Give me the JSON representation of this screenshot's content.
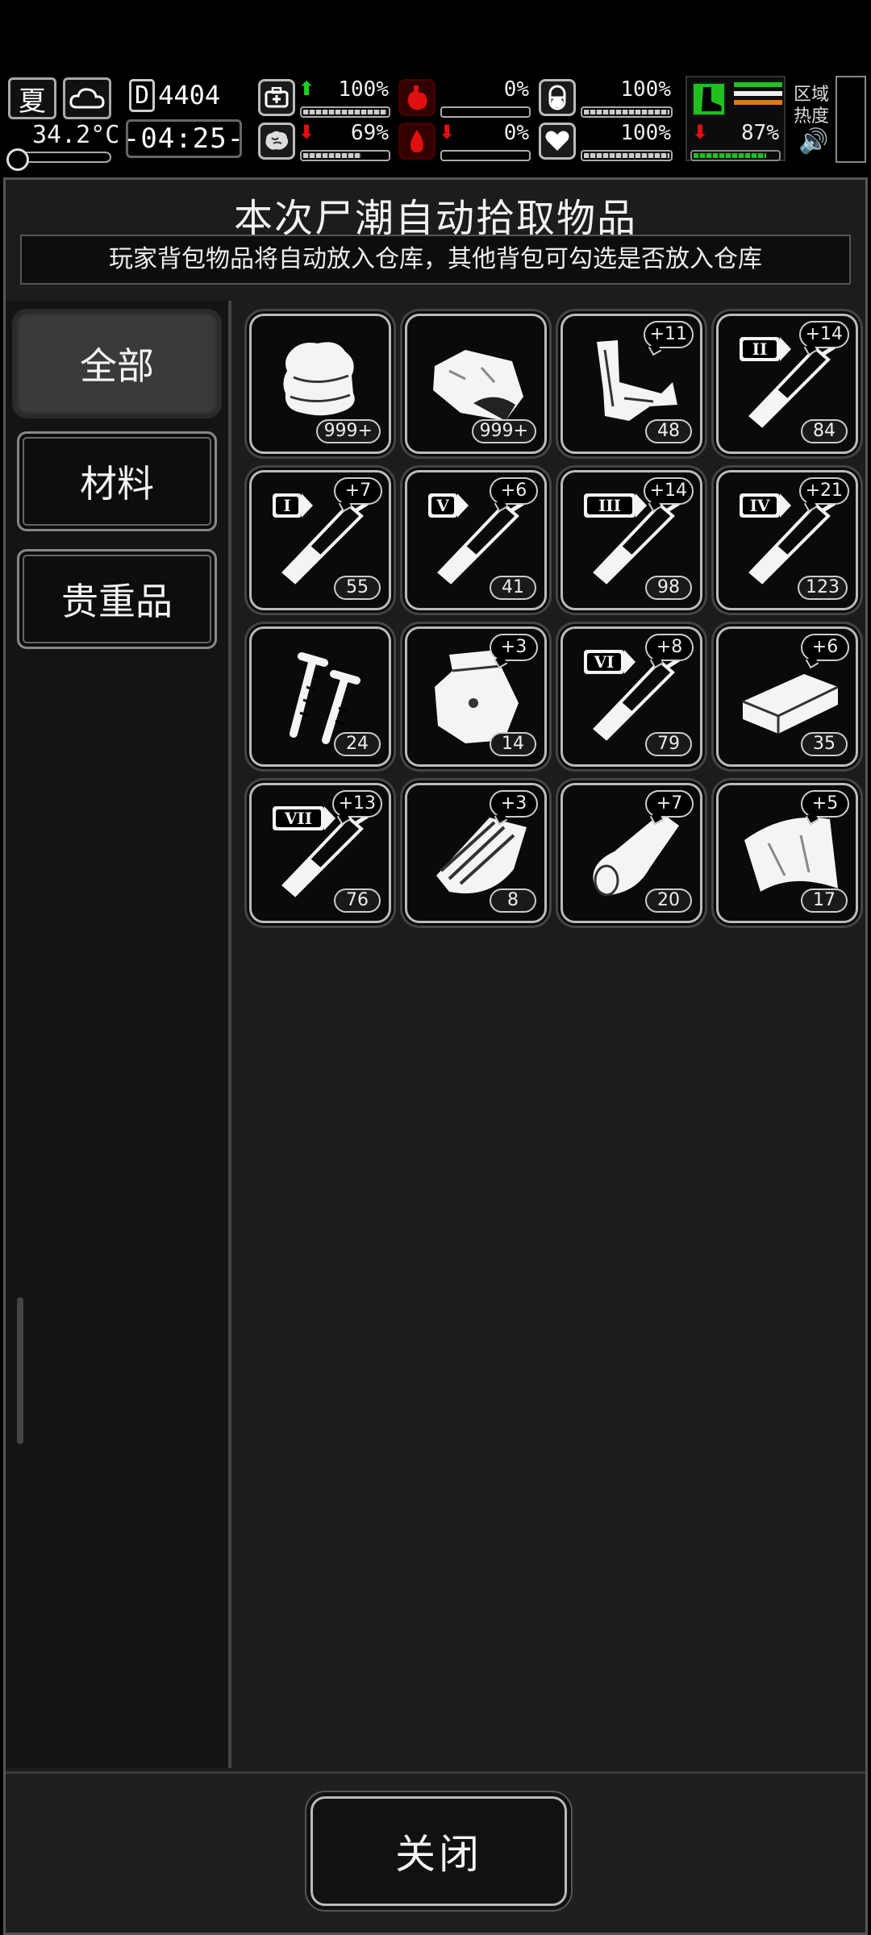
{
  "hud": {
    "season": "夏",
    "temperature": "34.2°C",
    "day": "4404",
    "day_prefix": "D",
    "clock": "-04:25-",
    "stats": [
      {
        "name": "health",
        "value": "100%",
        "trend": "up"
      },
      {
        "name": "hunger",
        "value": "0%",
        "trend": "none"
      },
      {
        "name": "pill",
        "value": "100%",
        "trend": "none"
      },
      {
        "name": "sanity",
        "value": "69%",
        "trend": "down"
      },
      {
        "name": "blood",
        "value": "0%",
        "trend": "down"
      },
      {
        "name": "heart",
        "value": "100%",
        "trend": "none"
      },
      {
        "name": "stamina",
        "value": "87%",
        "trend": "down"
      }
    ],
    "area_label_1": "区域",
    "area_label_2": "热度"
  },
  "panel": {
    "title": "本次尸潮自动拾取物品",
    "subtitle": "玩家背包物品将自动放入仓库，其他背包可勾选是否放入仓库"
  },
  "tabs": [
    {
      "label": "全部",
      "active": true
    },
    {
      "label": "材料",
      "active": false
    },
    {
      "label": "贵重品",
      "active": false
    }
  ],
  "items": [
    {
      "icon": "cloth-icon",
      "count": "999+",
      "plus": ""
    },
    {
      "icon": "meat-icon",
      "count": "999+",
      "plus": ""
    },
    {
      "icon": "scrap-metal-icon",
      "count": "48",
      "plus": "+11"
    },
    {
      "icon": "syringe-icon",
      "tier": "II",
      "count": "84",
      "plus": "+14"
    },
    {
      "icon": "syringe-icon",
      "tier": "I",
      "count": "55",
      "plus": "+7"
    },
    {
      "icon": "syringe-icon",
      "tier": "V",
      "count": "41",
      "plus": "+6"
    },
    {
      "icon": "syringe-icon",
      "tier": "III",
      "count": "98",
      "plus": "+14"
    },
    {
      "icon": "syringe-icon",
      "tier": "IV",
      "count": "123",
      "plus": "+21"
    },
    {
      "icon": "nails-icon",
      "count": "24",
      "plus": ""
    },
    {
      "icon": "bag-icon",
      "count": "14",
      "plus": "+3"
    },
    {
      "icon": "syringe-icon",
      "tier": "VI",
      "count": "79",
      "plus": "+8"
    },
    {
      "icon": "plank-icon",
      "count": "35",
      "plus": "+6"
    },
    {
      "icon": "syringe-icon",
      "tier": "VII",
      "count": "76",
      "plus": "+13"
    },
    {
      "icon": "wood-icon",
      "count": "8",
      "plus": "+3"
    },
    {
      "icon": "log-icon",
      "count": "20",
      "plus": "+7"
    },
    {
      "icon": "leather-icon",
      "count": "17",
      "plus": "+5"
    }
  ],
  "footer": {
    "close_label": "关闭"
  },
  "colors": {
    "up": "#20d020",
    "down": "#e01010"
  }
}
